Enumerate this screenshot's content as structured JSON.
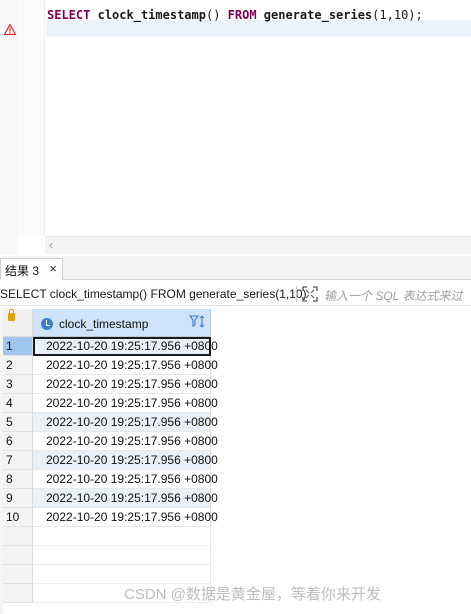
{
  "editor": {
    "code_keyword_select": "SELECT",
    "code_func": "clock_timestamp",
    "code_parens": "()",
    "code_keyword_from": "FROM",
    "code_func2": "generate_series",
    "code_args": "(1,10);"
  },
  "results": {
    "tab_label": "结果 3",
    "tab_close": "×",
    "query_text": "SELECT clock_timestamp() FROM generate_series(1,10)",
    "filter_placeholder": "输入一个 SQL 表达式来过",
    "column_header": "clock_timestamp",
    "rows": [
      {
        "num": "1",
        "value": "2022-10-20 19:25:17.956 +0800"
      },
      {
        "num": "2",
        "value": "2022-10-20 19:25:17.956 +0800"
      },
      {
        "num": "3",
        "value": "2022-10-20 19:25:17.956 +0800"
      },
      {
        "num": "4",
        "value": "2022-10-20 19:25:17.956 +0800"
      },
      {
        "num": "5",
        "value": "2022-10-20 19:25:17.956 +0800"
      },
      {
        "num": "6",
        "value": "2022-10-20 19:25:17.956 +0800"
      },
      {
        "num": "7",
        "value": "2022-10-20 19:25:17.956 +0800"
      },
      {
        "num": "8",
        "value": "2022-10-20 19:25:17.956 +0800"
      },
      {
        "num": "9",
        "value": "2022-10-20 19:25:17.956 +0800"
      },
      {
        "num": "10",
        "value": "2022-10-20 19:25:17.956 +0800"
      }
    ]
  },
  "watermark": "CSDN @数据是黄金屋，等着你来开发",
  "icons": {
    "warning": "warning-icon",
    "lock": "lock-icon",
    "clock": "clock-icon",
    "sort_filter": "filter-sort-icon",
    "expand": "expand-icon"
  },
  "colors": {
    "keyword": "#7f0055",
    "header_bg": "#cfe3f8",
    "selected_row": "#9fc6ee",
    "alt_row": "#e9f0fa"
  }
}
